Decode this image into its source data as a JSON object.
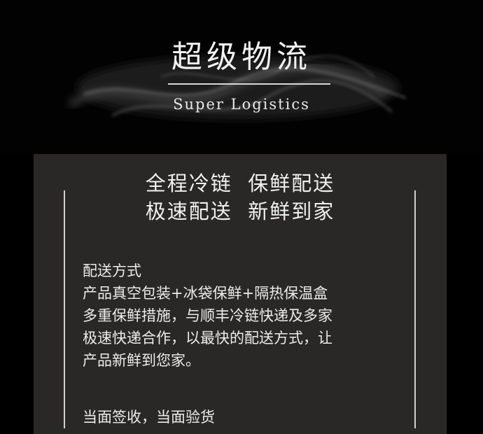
{
  "header": {
    "title": "超级物流",
    "subtitle": "Super Logistics"
  },
  "card": {
    "slogan_line1": "全程冷链  保鲜配送",
    "slogan_line2": "极速配送  新鲜到家",
    "section1": {
      "heading": "配送方式",
      "lines": [
        "产品真空包装+冰袋保鲜+隔热保温盒",
        "多重保鲜措施，与顺丰冷链快递及多家",
        "极速快递合作，以最快的配送方式，让",
        "产品新鲜到您家。"
      ]
    },
    "section2": {
      "heading": "当面签收，当面验货"
    }
  },
  "colors": {
    "background": "#000000",
    "card": "#2a2827",
    "text": "#ececec",
    "rule": "#d0d0d0"
  }
}
